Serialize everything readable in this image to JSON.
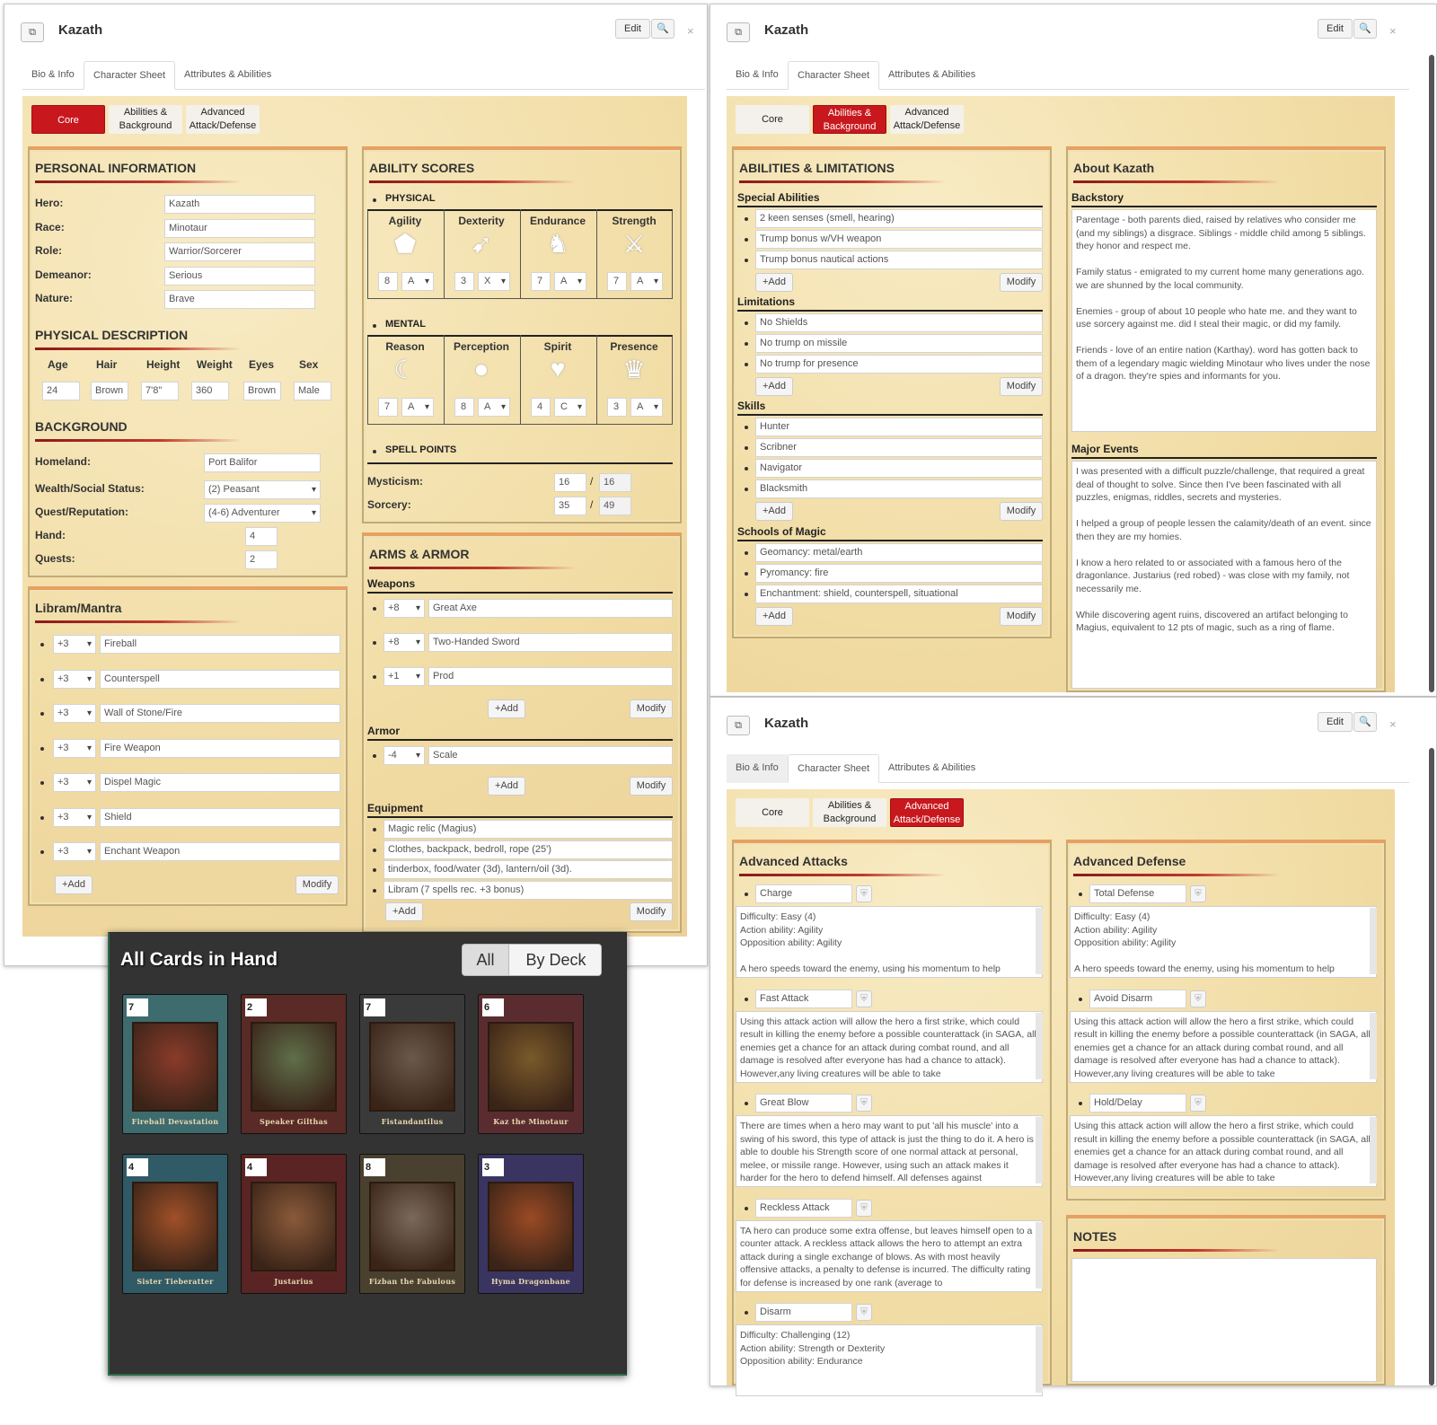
{
  "window_a": {
    "title": "Kazath",
    "edit": "Edit",
    "tabs": [
      "Bio & Info",
      "Character Sheet",
      "Attributes & Abilities"
    ],
    "subtabs": [
      "Core",
      "Abilities & Background",
      "Advanced Attack/Defense"
    ],
    "subtab_lines": [
      [
        "Core"
      ],
      [
        "Abilities &",
        "Background"
      ],
      [
        "Advanced",
        "Attack/Defense"
      ]
    ],
    "personal": {
      "title": "PERSONAL INFORMATION",
      "fields": [
        {
          "label": "Hero:",
          "value": "Kazath"
        },
        {
          "label": "Race:",
          "value": "Minotaur"
        },
        {
          "label": "Role:",
          "value": "Warrior/Sorcerer"
        },
        {
          "label": "Demeanor:",
          "value": "Serious"
        },
        {
          "label": "Nature:",
          "value": "Brave"
        }
      ]
    },
    "physical": {
      "title": "PHYSICAL DESCRIPTION",
      "headers": [
        "Age",
        "Hair",
        "Height",
        "Weight",
        "Eyes",
        "Sex"
      ],
      "values": [
        "24",
        "Brown",
        "7'8\"",
        "360",
        "Brown",
        "Male"
      ]
    },
    "background": {
      "title": "BACKGROUND",
      "homeland_label": "Homeland:",
      "homeland": "Port Balifor",
      "wealth_label": "Wealth/Social Status:",
      "wealth": "(2) Peasant",
      "quest_label": "Quest/Reputation:",
      "quest": "(4-6) Adventurer",
      "hand_label": "Hand:",
      "hand": "4",
      "quests_label": "Quests:",
      "quests": "2"
    },
    "libram": {
      "title": "Libram/Mantra",
      "items": [
        {
          "mod": "+3",
          "name": "Fireball"
        },
        {
          "mod": "+3",
          "name": "Counterspell"
        },
        {
          "mod": "+3",
          "name": "Wall of Stone/Fire"
        },
        {
          "mod": "+3",
          "name": "Fire Weapon"
        },
        {
          "mod": "+3",
          "name": "Dispel Magic"
        },
        {
          "mod": "+3",
          "name": "Shield"
        },
        {
          "mod": "+3",
          "name": "Enchant Weapon"
        }
      ],
      "add": "+Add",
      "modify": "Modify"
    },
    "ability": {
      "title": "ABILITY SCORES",
      "physical_label": "PHYSICAL",
      "physical": [
        {
          "name": "Agility",
          "score": "8",
          "code": "A"
        },
        {
          "name": "Dexterity",
          "score": "3",
          "code": "X"
        },
        {
          "name": "Endurance",
          "score": "7",
          "code": "A"
        },
        {
          "name": "Strength",
          "score": "7",
          "code": "A"
        }
      ],
      "mental_label": "MENTAL",
      "mental": [
        {
          "name": "Reason",
          "score": "7",
          "code": "A"
        },
        {
          "name": "Perception",
          "score": "8",
          "code": "A"
        },
        {
          "name": "Spirit",
          "score": "4",
          "code": "C"
        },
        {
          "name": "Presence",
          "score": "3",
          "code": "A"
        }
      ],
      "spell_label": "SPELL POINTS",
      "mysticism_label": "Mysticism:",
      "mysticism": "16",
      "mysticism_max": "16",
      "sorcery_label": "Sorcery:",
      "sorcery": "35",
      "sorcery_max": "49"
    },
    "arms": {
      "title": "ARMS & ARMOR",
      "weapons_label": "Weapons",
      "weapons": [
        {
          "mod": "+8",
          "name": "Great Axe"
        },
        {
          "mod": "+8",
          "name": "Two-Handed Sword"
        },
        {
          "mod": "+1",
          "name": "Prod"
        }
      ],
      "armor_label": "Armor",
      "armor": [
        {
          "mod": "-4",
          "name": "Scale"
        }
      ],
      "equipment_label": "Equipment",
      "equipment": [
        "Magic relic (Magius)",
        "Clothes, backpack, bedroll, rope (25')",
        "tinderbox, food/water (3d), lantern/oil (3d).",
        "Libram (7 spells rec. +3 bonus)"
      ],
      "add": "+Add",
      "modify": "Modify"
    }
  },
  "window_b": {
    "title": "Kazath",
    "edit": "Edit",
    "abilities": {
      "title": "ABILITIES & LIMITATIONS",
      "special_label": "Special Abilities",
      "special": [
        "2 keen senses (smell, hearing)",
        "Trump bonus w/VH weapon",
        "Trump bonus nautical actions"
      ],
      "limitations_label": "Limitations",
      "limitations": [
        "No Shields",
        "No trump on missile",
        "No trump for presence"
      ],
      "skills_label": "Skills",
      "skills": [
        "Hunter",
        "Scribner",
        "Navigator",
        "Blacksmith"
      ],
      "schools_label": "Schools of Magic",
      "schools": [
        "Geomancy: metal/earth",
        "Pyromancy: fire",
        "Enchantment: shield, counterspell, situational"
      ],
      "add": "+Add",
      "modify": "Modify"
    },
    "about": {
      "title": "About Kazath",
      "backstory_label": "Backstory",
      "backstory": "Parentage - both parents died, raised by relatives who consider me (and my siblings) a disgrace. Siblings - middle child among 5 siblings. they honor and respect me.\n\nFamily status - emigrated to my current home many generations ago. we are shunned by the local community.\n\nEnemies - group of about 10 people who hate me. and they want to use sorcery against me. did I steal their magic, or did my family.\n\nFriends - love of an entire nation (Karthay). word has gotten back to them of a legendary magic wielding Minotaur who lives under the nose of a dragon. they're spies and informants for you.",
      "events_label": "Major Events",
      "events": "I was presented with a difficult puzzle/challenge, that required a great deal of thought to solve. Since then I've been fascinated with all puzzles, enigmas, riddles, secrets and mysteries.\n\nI helped a group of people lessen the calamity/death of an event. since then they are my homies.\n\nI know a hero related to or associated with a famous hero of the dragonlance. Justarius (red robed) - was close with my family, not necessarily me.\n\nWhile discovering agent ruins, discovered an artifact belonging to Magius, equivalent to 12 pts of magic, such as a ring of flame."
    }
  },
  "window_c": {
    "title": "Kazath",
    "edit": "Edit",
    "attacks": {
      "title": "Advanced Attacks",
      "items": [
        {
          "name": "Charge",
          "text": "Difficulty: Easy (4)\nAction ability: Agility\nOpposition ability: Agility\n\nA hero speeds toward the enemy, using his momentum to help"
        },
        {
          "name": "Fast Attack",
          "text": "Using this attack action will allow the hero a first strike, which could result in killing the enemy before a possible counterattack (in SAGA, all enemies get a chance for an attack during combat round, and all damage is resolved after everyone has had a chance to attack). However,any living creatures will be able to take"
        },
        {
          "name": "Great Blow",
          "text": "There are times when a hero may want to put 'all his muscle' into a swing of his sword, this type of attack is just the thing to do it. A hero is able to double his Strength score of one normal attack at personal, melee, or missile range. However, using such an attack makes it harder for the hero to defend himself. All defenses against"
        },
        {
          "name": "Reckless Attack",
          "text": "TA hero can produce some extra offense, but leaves himself open to a counter attack. A reckless attack allows the hero to attempt an extra attack during a single exchange of blows. As with most heavily offensive attacks, a penalty to defense is incurred. The difficulty rating for defense is increased by one rank (average to"
        },
        {
          "name": "Disarm",
          "text": "Difficulty: Challenging (12)\nAction ability: Strength or Dexterity\nOpposition ability: Endurance"
        }
      ]
    },
    "defense": {
      "title": "Advanced Defense",
      "items": [
        {
          "name": "Total Defense",
          "text": "Difficulty: Easy (4)\nAction ability: Agility\nOpposition ability: Agility\n\nA hero speeds toward the enemy, using his momentum to help"
        },
        {
          "name": "Avoid Disarm",
          "text": "Using this attack action will allow the hero a first strike, which could result in killing the enemy before a possible counterattack (in SAGA, all enemies get a chance for an attack during combat round, and all damage is resolved after everyone has had a chance to attack). However,any living creatures will be able to take"
        },
        {
          "name": "Hold/Delay",
          "text": "Using this attack action will allow the hero a first strike, which could result in killing the enemy before a possible counterattack (in SAGA, all enemies get a chance for an attack during combat round, and all damage is resolved after everyone has had a chance to attack). However,any living creatures will be able to take"
        }
      ]
    },
    "notes_title": "NOTES"
  },
  "cards": {
    "title": "All Cards in Hand",
    "toggle": [
      "All",
      "By Deck"
    ],
    "list": [
      {
        "num": "7",
        "name": "Fireball Devastation",
        "bg": "#3d6b6e",
        "art": "#8a3b2a"
      },
      {
        "num": "2",
        "name": "Speaker Gilthas",
        "bg": "#5a2a26",
        "art": "#5f6f4a"
      },
      {
        "num": "7",
        "name": "Fistandantilus",
        "bg": "#3a3a3a",
        "art": "#6a5a4a"
      },
      {
        "num": "6",
        "name": "Kaz the Minotaur",
        "bg": "#5a2c30",
        "art": "#7a5a2a"
      },
      {
        "num": "4",
        "name": "Sister Tieberatter",
        "bg": "#2f5a66",
        "art": "#a05028"
      },
      {
        "num": "4",
        "name": "Justarius",
        "bg": "#5a2424",
        "art": "#8a5a3a"
      },
      {
        "num": "8",
        "name": "Fizban the Fabulous",
        "bg": "#4a4030",
        "art": "#7a6a5a"
      },
      {
        "num": "3",
        "name": "Hyma Dragonbane",
        "bg": "#3a3460",
        "art": "#9a4a24"
      }
    ]
  },
  "colors": {
    "accent": "#c8181e",
    "parchment": "#f3e2b0",
    "panel_border": "#c4aa72",
    "card_bg": "#333333"
  }
}
